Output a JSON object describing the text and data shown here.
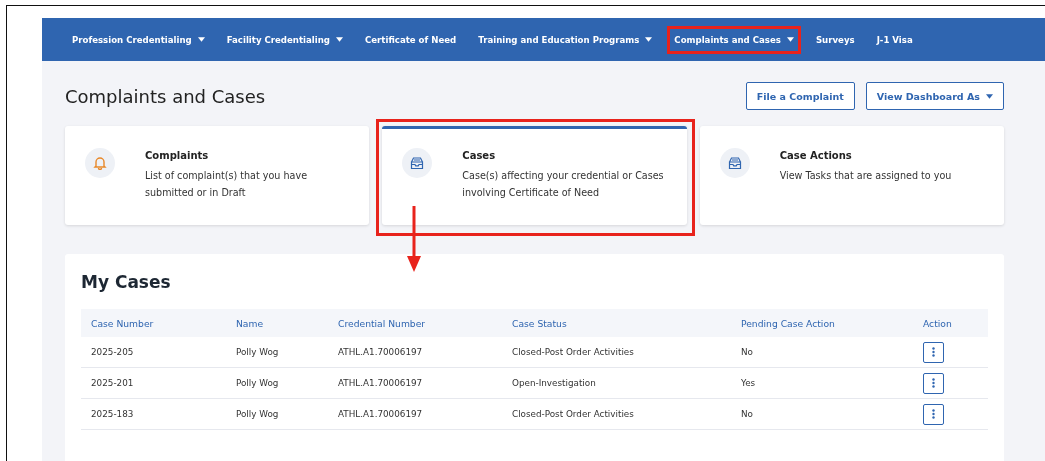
{
  "nav": {
    "items": [
      {
        "label": "Profession Credentialing",
        "dropdown": true,
        "highlighted": false
      },
      {
        "label": "Facility Credentialing",
        "dropdown": true,
        "highlighted": false
      },
      {
        "label": "Certificate of Need",
        "dropdown": false,
        "highlighted": false
      },
      {
        "label": "Training and Education Programs",
        "dropdown": true,
        "highlighted": false
      },
      {
        "label": "Complaints and Cases",
        "dropdown": true,
        "highlighted": true
      },
      {
        "label": "Surveys",
        "dropdown": false,
        "highlighted": false
      },
      {
        "label": "J-1 Visa",
        "dropdown": false,
        "highlighted": false
      }
    ]
  },
  "page": {
    "title": "Complaints and Cases",
    "buttons": [
      {
        "label": "File a Complaint",
        "dropdown": false
      },
      {
        "label": "View Dashboard As",
        "dropdown": true
      }
    ]
  },
  "cards": [
    {
      "title": "Complaints",
      "description": "List of complaint(s) that you have submitted or in Draft",
      "kind": "alert",
      "selected": false,
      "highlighted": false
    },
    {
      "title": "Cases",
      "description": "Case(s) affecting your credential or Cases involving Certificate of Need",
      "kind": "inbox",
      "selected": true,
      "highlighted": true
    },
    {
      "title": "Case Actions",
      "description": "View Tasks that are assigned to you",
      "kind": "inbox",
      "selected": false,
      "highlighted": false
    }
  ],
  "my_cases": {
    "title": "My Cases",
    "columns": [
      "Case Number",
      "Name",
      "Credential Number",
      "Case Status",
      "Pending Case Action",
      "Action"
    ],
    "rows": [
      {
        "cells": [
          "2025-205",
          "Polly Wog",
          "ATHL.A1.70006197",
          "Closed-Post Order Activities",
          "No"
        ]
      },
      {
        "cells": [
          "2025-201",
          "Polly Wog",
          "ATHL.A1.70006197",
          "Open-Investigation",
          "Yes"
        ]
      },
      {
        "cells": [
          "2025-183",
          "Polly Wog",
          "ATHL.A1.70006197",
          "Closed-Post Order Activities",
          "No"
        ]
      }
    ]
  }
}
